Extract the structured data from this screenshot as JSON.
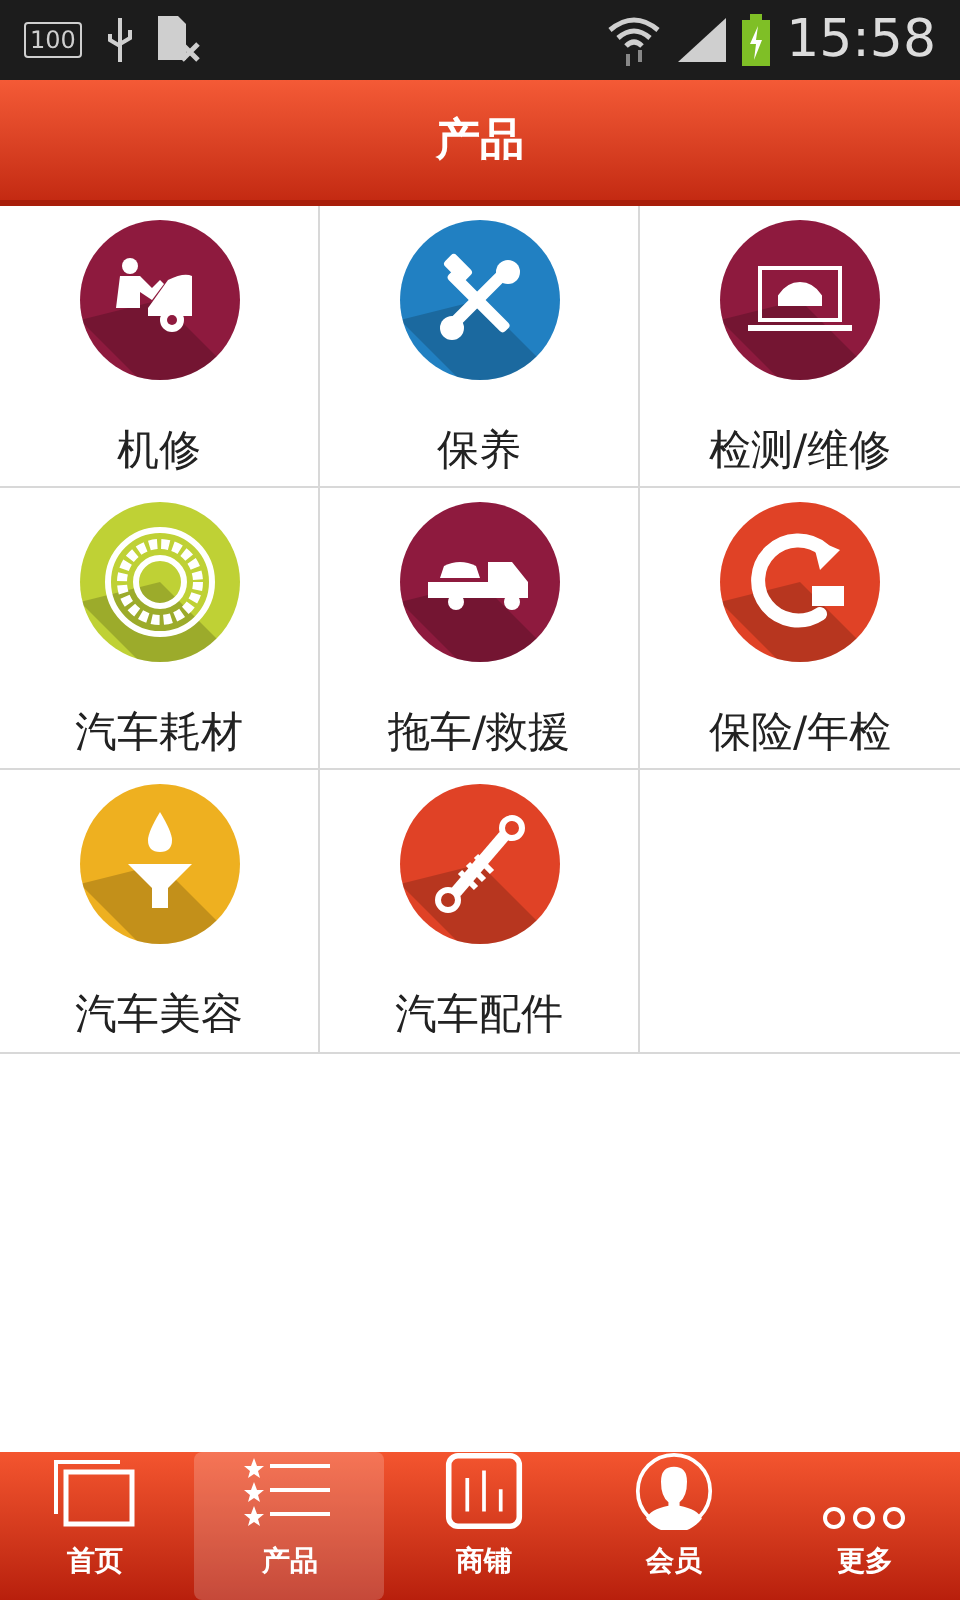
{
  "status_bar": {
    "battery_text": "100",
    "time": "15:58"
  },
  "header": {
    "title": "产品"
  },
  "products": [
    {
      "label": "机修",
      "kind": "mechanic",
      "color": "#8e1a3e"
    },
    {
      "label": "保养",
      "kind": "tools",
      "color": "#2180c2"
    },
    {
      "label": "检测/维修",
      "kind": "laptop",
      "color": "#8e1a3e"
    },
    {
      "label": "汽车耗材",
      "kind": "bearing",
      "color": "#bfd135"
    },
    {
      "label": "拖车/救援",
      "kind": "towtruck",
      "color": "#8e1a3e"
    },
    {
      "label": "保险/年检",
      "kind": "renew",
      "color": "#e04226"
    },
    {
      "label": "汽车美容",
      "kind": "funnel",
      "color": "#eeb020"
    },
    {
      "label": "汽车配件",
      "kind": "shock",
      "color": "#e04226"
    }
  ],
  "nav": [
    {
      "label": "首页",
      "kind": "home",
      "selected": false
    },
    {
      "label": "产品",
      "kind": "list",
      "selected": true
    },
    {
      "label": "商铺",
      "kind": "chart",
      "selected": false
    },
    {
      "label": "会员",
      "kind": "person",
      "selected": false
    },
    {
      "label": "更多",
      "kind": "more",
      "selected": false
    }
  ]
}
